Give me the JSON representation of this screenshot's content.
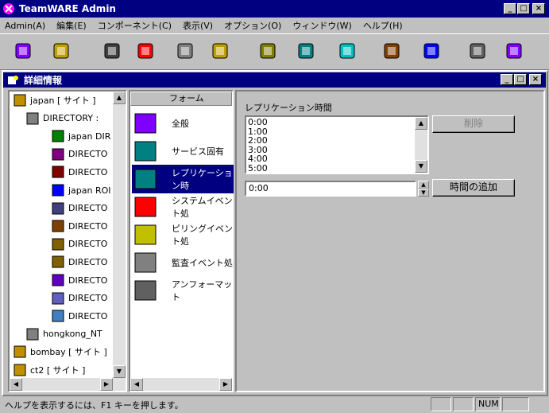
{
  "app": {
    "title": "TeamWARE Admin"
  },
  "menu": [
    "Admin(A)",
    "編集(E)",
    "コンポーネント(C)",
    "表示(V)",
    "オプション(O)",
    "ウィンドウ(W)",
    "ヘルプ(H)"
  ],
  "toolbar": [
    "network-icon",
    "users-icon",
    "connector-icon",
    "stop-alert-icon",
    "tape-icon",
    "binary-coins-icon",
    "gears-icon",
    "chart-icon",
    "cylinder-icon",
    "person-icon",
    "org-icon",
    "printer-icon",
    "puzzle-icon"
  ],
  "child": {
    "title": "詳細情報"
  },
  "tree": {
    "nodes": [
      {
        "label": "japan [ サイト ]",
        "indent": 0
      },
      {
        "label": "DIRECTORY :",
        "indent": 1
      },
      {
        "label": "japan DIR",
        "indent": 2
      },
      {
        "label": "DIRECTO",
        "indent": 2
      },
      {
        "label": "DIRECTO",
        "indent": 2
      },
      {
        "label": "japan ROI",
        "indent": 2
      },
      {
        "label": "DIRECTO",
        "indent": 2
      },
      {
        "label": "DIRECTO",
        "indent": 2
      },
      {
        "label": "DIRECTO",
        "indent": 2
      },
      {
        "label": "DIRECTO",
        "indent": 2
      },
      {
        "label": "DIRECTO",
        "indent": 2
      },
      {
        "label": "DIRECTO",
        "indent": 2
      },
      {
        "label": "DIRECTO",
        "indent": 2
      },
      {
        "label": "hongkong_NT",
        "indent": 1
      },
      {
        "label": "bombay [ サイト ]",
        "indent": 0
      },
      {
        "label": "ct2 [ サイト ]",
        "indent": 0
      }
    ]
  },
  "forms": {
    "header": "フォーム",
    "items": [
      "全般",
      "サービス固有",
      "レプリケーション時",
      "システムイベント処",
      "ピリングイベント処",
      "監査イベント処",
      "アンフォーマット"
    ],
    "selected_index": 2
  },
  "replication": {
    "label": "レプリケーション時間",
    "times": [
      "0:00",
      "1:00",
      "2:00",
      "3:00",
      "4:00",
      "5:00"
    ],
    "input_value": "0:00",
    "delete_label": "削除",
    "add_label": "時間の追加"
  },
  "status": {
    "message": "ヘルプを表示するには、F1 キーを押します。",
    "num": "NUM"
  }
}
